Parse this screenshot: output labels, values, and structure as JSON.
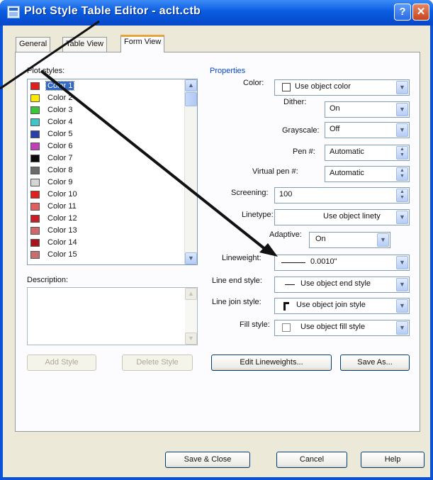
{
  "window": {
    "title": "Plot Style Table Editor - aclt.ctb",
    "help_glyph": "?",
    "close_glyph": "✕"
  },
  "tabs": [
    "General",
    "Table View",
    "Form View"
  ],
  "plot_styles": {
    "label": "Plot styles:",
    "items": [
      {
        "name": "Color 1",
        "color": "#e0201c",
        "selected": true
      },
      {
        "name": "Color 2",
        "color": "#ffea00"
      },
      {
        "name": "Color 3",
        "color": "#3cc43c"
      },
      {
        "name": "Color 4",
        "color": "#3fc6c8"
      },
      {
        "name": "Color 5",
        "color": "#2a3fa8"
      },
      {
        "name": "Color 6",
        "color": "#c23fb8"
      },
      {
        "name": "Color 7",
        "color": "#0a0a0a"
      },
      {
        "name": "Color 8",
        "color": "#6b6b6b"
      },
      {
        "name": "Color 9",
        "color": "#d6d6d6"
      },
      {
        "name": "Color 10",
        "color": "#e0201c"
      },
      {
        "name": "Color 11",
        "color": "#e06060"
      },
      {
        "name": "Color 12",
        "color": "#c81e28"
      },
      {
        "name": "Color 13",
        "color": "#d06a6a"
      },
      {
        "name": "Color 14",
        "color": "#a8141e"
      },
      {
        "name": "Color 15",
        "color": "#c86e6e"
      }
    ]
  },
  "description": {
    "label": "Description:",
    "value": ""
  },
  "properties": {
    "group_label": "Properties",
    "color": {
      "label": "Color:",
      "value": "Use object color"
    },
    "dither": {
      "label": "Dither:",
      "value": "On"
    },
    "grayscale": {
      "label": "Grayscale:",
      "value": "Off"
    },
    "pen": {
      "label": "Pen #:",
      "value": "Automatic"
    },
    "virtual_pen": {
      "label": "Virtual pen #:",
      "value": "Automatic"
    },
    "screening": {
      "label": "Screening:",
      "value": "100"
    },
    "linetype": {
      "label": "Linetype:",
      "value": "Use object linety"
    },
    "adaptive": {
      "label": "Adaptive:",
      "value": "On"
    },
    "lineweight": {
      "label": "Lineweight:",
      "value": "0.0010\""
    },
    "line_end": {
      "label": "Line end style:",
      "value": "Use object end style"
    },
    "line_join": {
      "label": "Line join style:",
      "value": "Use object join style"
    },
    "fill": {
      "label": "Fill style:",
      "value": "Use object fill style"
    }
  },
  "buttons": {
    "add_style": "Add Style",
    "delete_style": "Delete Style",
    "edit_lineweights": "Edit Lineweights...",
    "save_as": "Save As...",
    "save_close": "Save & Close",
    "cancel": "Cancel",
    "help": "Help"
  },
  "glyphs": {
    "up": "▲",
    "down": "▼"
  },
  "colors": {
    "title_blue": "#0a5ce0",
    "dialog_bg": "#ece9d8",
    "selection": "#316ac5",
    "accent_tab": "#e8a33d"
  }
}
